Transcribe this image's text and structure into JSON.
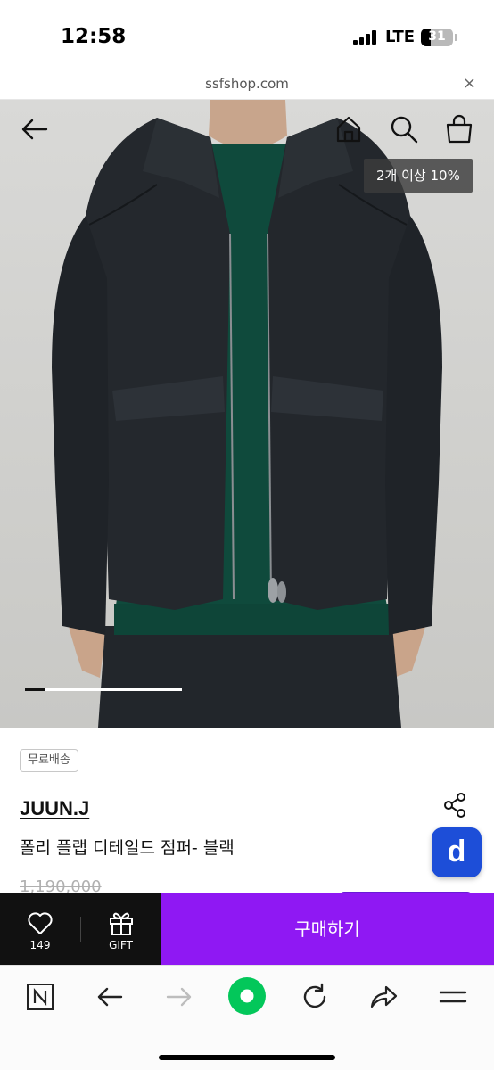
{
  "status_bar": {
    "time": "12:58",
    "network": "LTE",
    "battery": "31"
  },
  "browser": {
    "url": "ssfshop.com",
    "close_symbol": "×"
  },
  "product_image": {
    "nav_icons": [
      "back-arrow-icon",
      "home-icon",
      "search-icon",
      "shopping-bag-icon"
    ],
    "discount_badge": "2개 이상 10%",
    "gallery_progress": 0.13
  },
  "product": {
    "shipping_tag": "무료배송",
    "brand": "JUUN.J",
    "name": "폴리 플랩 디테일드 점퍼- 블랙",
    "original_price": "1,190,000",
    "floating_button_label": "d"
  },
  "purchase_bar": {
    "like_count": "149",
    "gift_label": "GIFT",
    "buy_label": "구매하기"
  },
  "toolbar": {
    "icons": [
      "naver-n-icon",
      "back-icon",
      "forward-icon",
      "green-home-icon",
      "reload-icon",
      "share-icon",
      "menu-icon"
    ]
  },
  "colors": {
    "accent_purple": "#8f18f3",
    "floating_blue": "#1d4ed8",
    "naver_green": "#03c75a"
  }
}
